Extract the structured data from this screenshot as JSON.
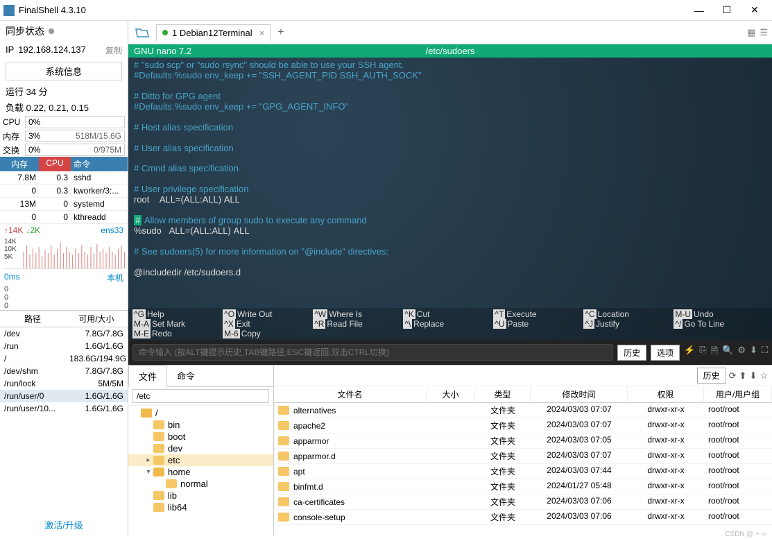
{
  "window": {
    "title": "FinalShell 4.3.10"
  },
  "sidebar": {
    "sync_label": "同步状态",
    "ip_label": "IP",
    "ip_value": "192.168.124.137",
    "copy_label": "复制",
    "sysinfo_btn": "系统信息",
    "uptime": "运行 34 分",
    "load": "负载 0.22, 0.21, 0.15",
    "cpu_label": "CPU",
    "cpu_pct": "0%",
    "mem_label": "内存",
    "mem_pct": "3%",
    "mem_ext": "518M/15.6G",
    "swap_label": "交换",
    "swap_pct": "0%",
    "swap_ext": "0/975M",
    "proc_hdr": {
      "mem": "内存",
      "cpu": "CPU",
      "cmd": "命令"
    },
    "procs": [
      {
        "mem": "7.8M",
        "cpu": "0.3",
        "cmd": "sshd"
      },
      {
        "mem": "0",
        "cpu": "0.3",
        "cmd": "kworker/3:..."
      },
      {
        "mem": "13M",
        "cpu": "0",
        "cmd": "systemd"
      },
      {
        "mem": "0",
        "cpu": "0",
        "cmd": "kthreadd"
      }
    ],
    "net_up": "↑14K",
    "net_dn": "↓2K",
    "iface": "ens33",
    "chart_ticks": [
      "14K",
      "10K",
      "5K"
    ],
    "lat_ms": "0ms",
    "lat_host": "本机",
    "lat_nums": [
      "0",
      "0",
      "0"
    ],
    "disk_hdr": {
      "path": "路径",
      "size": "可用/大小"
    },
    "disks": [
      {
        "p": "/dev",
        "s": "7.8G/7.8G"
      },
      {
        "p": "/run",
        "s": "1.6G/1.6G"
      },
      {
        "p": "/",
        "s": "183.6G/194.9G"
      },
      {
        "p": "/dev/shm",
        "s": "7.8G/7.8G"
      },
      {
        "p": "/run/lock",
        "s": "5M/5M"
      },
      {
        "p": "/run/user/0",
        "s": "1.6G/1.6G"
      },
      {
        "p": "/run/user/10...",
        "s": "1.6G/1.6G"
      }
    ],
    "activate": "激活/升级"
  },
  "tabs": {
    "main": "1 Debian12Terminal"
  },
  "terminal": {
    "editor": "GNU nano 7.2",
    "file": "/etc/sudoers",
    "lines": [
      {
        "t": "# \"sudo scp\" or \"sudo rsync\" should be able to use your SSH agent.",
        "cls": "c"
      },
      {
        "t": "#Defaults:%sudo env_keep += \"SSH_AGENT_PID SSH_AUTH_SOCK\"",
        "cls": "c"
      },
      {
        "t": " ",
        "cls": "c"
      },
      {
        "t": "# Ditto for GPG agent",
        "cls": "c"
      },
      {
        "t": "#Defaults:%sudo env_keep += \"GPG_AGENT_INFO\"",
        "cls": "c"
      },
      {
        "t": " ",
        "cls": "c"
      },
      {
        "t": "# Host alias specification",
        "cls": "c"
      },
      {
        "t": " ",
        "cls": "c"
      },
      {
        "t": "# User alias specification",
        "cls": "c"
      },
      {
        "t": " ",
        "cls": "c"
      },
      {
        "t": "# Cmnd alias specification",
        "cls": "c"
      },
      {
        "t": " ",
        "cls": "c"
      },
      {
        "t": "# User privilege specification",
        "cls": "c"
      },
      {
        "t": "root    ALL=(ALL:ALL) ALL",
        "cls": "w"
      },
      {
        "t": " ",
        "cls": "c"
      },
      {
        "t": "# Allow members of group sudo to execute any command",
        "cls": "c",
        "cursor": true
      },
      {
        "t": "%sudo   ALL=(ALL:ALL) ALL",
        "cls": "w"
      },
      {
        "t": " ",
        "cls": "c"
      },
      {
        "t": "# See sudoers(5) for more information on \"@include\" directives:",
        "cls": "c"
      },
      {
        "t": " ",
        "cls": "c"
      },
      {
        "t": "@includedir /etc/sudoers.d",
        "cls": "w"
      }
    ],
    "shortcuts": [
      {
        "k": "^G",
        "l": "Help"
      },
      {
        "k": "^O",
        "l": "Write Out"
      },
      {
        "k": "^W",
        "l": "Where Is"
      },
      {
        "k": "^K",
        "l": "Cut"
      },
      {
        "k": "^T",
        "l": "Execute"
      },
      {
        "k": "^C",
        "l": "Location"
      },
      {
        "k": "M-U",
        "l": "Undo"
      },
      {
        "k": "M-A",
        "l": "Set Mark"
      },
      {
        "k": "^X",
        "l": "Exit"
      },
      {
        "k": "^R",
        "l": "Read File"
      },
      {
        "k": "^\\",
        "l": "Replace"
      },
      {
        "k": "^U",
        "l": "Paste"
      },
      {
        "k": "^J",
        "l": "Justify"
      },
      {
        "k": "^/",
        "l": "Go To Line"
      },
      {
        "k": "M-E",
        "l": "Redo"
      },
      {
        "k": "M-6",
        "l": "Copy"
      }
    ]
  },
  "cmdbar": {
    "placeholder": "命令输入 (按ALT键提示历史,TAB键路径,ESC键返回,双击CTRL切换)",
    "history": "历史",
    "options": "选项"
  },
  "bottom": {
    "tabs": {
      "file": "文件",
      "cmd": "命令"
    },
    "path": "/etc",
    "history": "历史",
    "tree": [
      {
        "name": "/",
        "depth": 0,
        "open": true,
        "arr": ""
      },
      {
        "name": "bin",
        "depth": 1,
        "arr": ""
      },
      {
        "name": "boot",
        "depth": 1,
        "arr": ""
      },
      {
        "name": "dev",
        "depth": 1,
        "arr": ""
      },
      {
        "name": "etc",
        "depth": 1,
        "sel": true,
        "arr": "▸"
      },
      {
        "name": "home",
        "depth": 1,
        "open": true,
        "arr": "▾"
      },
      {
        "name": "normal",
        "depth": 2,
        "arr": ""
      },
      {
        "name": "lib",
        "depth": 1,
        "arr": ""
      },
      {
        "name": "lib64",
        "depth": 1,
        "arr": ""
      }
    ],
    "cols": {
      "name": "文件名",
      "size": "大小",
      "type": "类型",
      "mtime": "修改时间",
      "perm": "权限",
      "owner": "用户/用户组"
    },
    "files": [
      {
        "n": "alternatives",
        "t": "文件夹",
        "m": "2024/03/03 07:07",
        "p": "drwxr-xr-x",
        "o": "root/root"
      },
      {
        "n": "apache2",
        "t": "文件夹",
        "m": "2024/03/03 07:07",
        "p": "drwxr-xr-x",
        "o": "root/root"
      },
      {
        "n": "apparmor",
        "t": "文件夹",
        "m": "2024/03/03 07:05",
        "p": "drwxr-xr-x",
        "o": "root/root"
      },
      {
        "n": "apparmor.d",
        "t": "文件夹",
        "m": "2024/03/03 07:07",
        "p": "drwxr-xr-x",
        "o": "root/root"
      },
      {
        "n": "apt",
        "t": "文件夹",
        "m": "2024/03/03 07:44",
        "p": "drwxr-xr-x",
        "o": "root/root"
      },
      {
        "n": "binfmt.d",
        "t": "文件夹",
        "m": "2024/01/27 05:48",
        "p": "drwxr-xr-x",
        "o": "root/root"
      },
      {
        "n": "ca-certificates",
        "t": "文件夹",
        "m": "2024/03/03 07:06",
        "p": "drwxr-xr-x",
        "o": "root/root"
      },
      {
        "n": "console-setup",
        "t": "文件夹",
        "m": "2024/03/03 07:06",
        "p": "drwxr-xr-x",
        "o": "root/root"
      }
    ]
  },
  "watermark": "CSDN @ + ∞"
}
